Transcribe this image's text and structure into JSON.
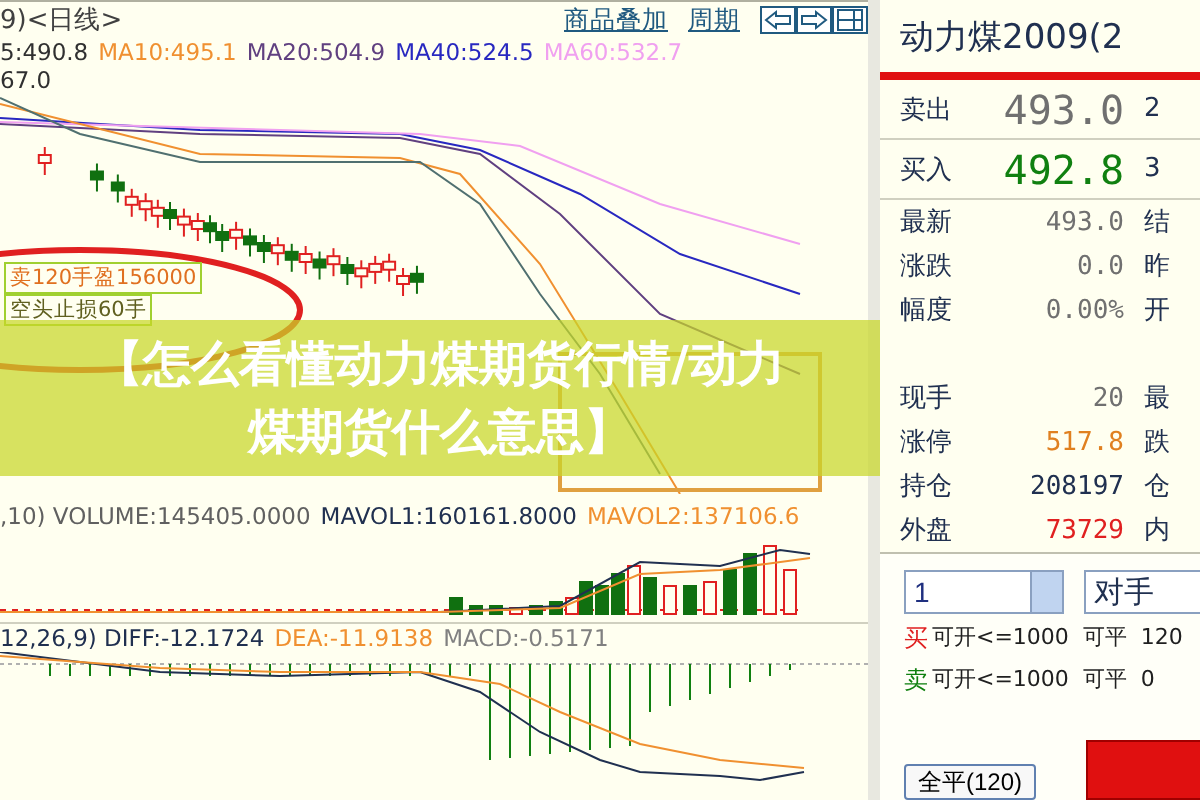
{
  "chart_header": {
    "title": "9)<日线>",
    "links": [
      "商品叠加",
      "周期"
    ]
  },
  "ma_legend": [
    {
      "text": "5:490.8",
      "color": "#303030"
    },
    {
      "text": "MA10:495.1",
      "color": "#f09030"
    },
    {
      "text": "MA20:504.9",
      "color": "#604080"
    },
    {
      "text": "MA40:524.5",
      "color": "#2828c0"
    },
    {
      "text": "MA60:532.7",
      "color": "#f0a0f0"
    }
  ],
  "price_label": "67.0",
  "annotations": [
    "卖120手盈156000",
    "空头止损60手"
  ],
  "volume_legend": [
    {
      "text": ",10) VOLUME:145405.0000",
      "color": "#606060"
    },
    {
      "text": "MAVOL1:160161.8000",
      "color": "#203050"
    },
    {
      "text": "MAVOL2:137106.6",
      "color": "#f09030"
    }
  ],
  "macd_legend": [
    {
      "text": "12,26,9) DIFF:-12.1724",
      "color": "#203050"
    },
    {
      "text": "DEA:-11.9138",
      "color": "#f09030"
    },
    {
      "text": "MACD:-0.5171",
      "color": "#808080"
    }
  ],
  "quote": {
    "title": "动力煤2009(2",
    "big_rows": [
      {
        "label": "卖出",
        "value": "493.0",
        "tail": "2",
        "color": "#707070"
      },
      {
        "label": "买入",
        "value": "492.8",
        "tail": "3",
        "color": "#108010"
      }
    ],
    "rows": [
      {
        "kind": "row",
        "label": "最新",
        "value": "493.0",
        "tail": "结",
        "color": "#707070"
      },
      {
        "kind": "row",
        "label": "涨跌",
        "value": "0.0",
        "tail": "昨",
        "color": "#707070"
      },
      {
        "kind": "row",
        "label": "幅度",
        "value": "0.00%",
        "tail": "开",
        "color": "#707070"
      },
      {
        "kind": "covered"
      },
      {
        "kind": "row",
        "label": "现手",
        "value": "20",
        "tail": "最",
        "color": "#707070"
      },
      {
        "kind": "row",
        "label": "涨停",
        "value": "517.8",
        "tail": "跌",
        "color": "#e08020"
      },
      {
        "kind": "row",
        "label": "持仓",
        "value": "208197",
        "tail": "仓",
        "color": "#203050"
      },
      {
        "kind": "row",
        "label": "外盘",
        "value": "73729",
        "tail": "内",
        "color": "#e02020"
      }
    ]
  },
  "order": {
    "quantity": "1",
    "price_button": "对手",
    "lines": [
      {
        "side": "买",
        "text": "可开<=1000  可平  120",
        "color": "#e02020"
      },
      {
        "side": "卖",
        "text": "可开<=1000  可平  0",
        "color": "#108010"
      }
    ],
    "close_all": "全平(120)"
  },
  "banner": [
    "【怎么看懂动力煤期货行情/动力",
    "煤期货什么意思】"
  ]
}
